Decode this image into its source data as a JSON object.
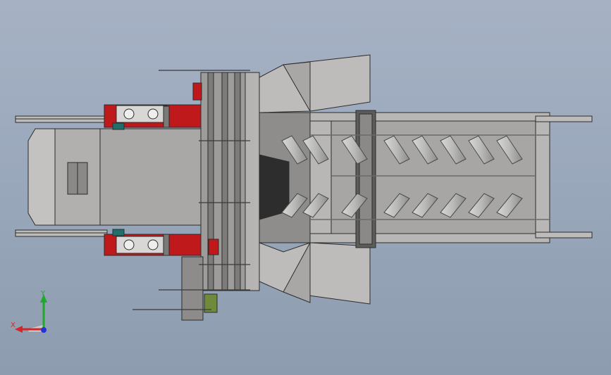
{
  "viewport": {
    "background_top": "#a6b2c4",
    "background_bottom": "#8e9cb0",
    "model": {
      "colors": {
        "body_gray": "#a3a2a0",
        "dark_gray": "#6f6f6d",
        "accent_red": "#c0191b",
        "accent_teal": "#1f6f6a",
        "accent_green": "#6f8a3a",
        "outline": "#2c2c2c"
      }
    }
  },
  "triad": {
    "x_label": "X",
    "y_label": "Y",
    "x_color": "#d4262a",
    "y_color": "#1faa2c",
    "z_color": "#2432d6"
  }
}
